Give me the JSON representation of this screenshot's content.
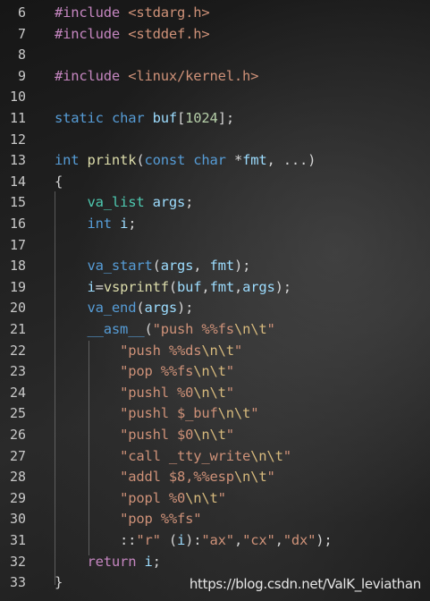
{
  "editor": {
    "lines": [
      {
        "n": "6",
        "tokens": [
          [
            "pre",
            "#include "
          ],
          [
            "inc",
            "<stdarg.h>"
          ]
        ]
      },
      {
        "n": "7",
        "tokens": [
          [
            "pre",
            "#include "
          ],
          [
            "inc",
            "<stddef.h>"
          ]
        ]
      },
      {
        "n": "8",
        "tokens": []
      },
      {
        "n": "9",
        "tokens": [
          [
            "pre",
            "#include "
          ],
          [
            "inc",
            "<linux/kernel.h>"
          ]
        ]
      },
      {
        "n": "10",
        "tokens": []
      },
      {
        "n": "11",
        "tokens": [
          [
            "kw",
            "static "
          ],
          [
            "kw",
            "char "
          ],
          [
            "var",
            "buf"
          ],
          [
            "plain",
            "["
          ],
          [
            "num",
            "1024"
          ],
          [
            "plain",
            "];"
          ]
        ]
      },
      {
        "n": "12",
        "tokens": []
      },
      {
        "n": "13",
        "tokens": [
          [
            "kw",
            "int "
          ],
          [
            "fn",
            "printk"
          ],
          [
            "plain",
            "("
          ],
          [
            "kw",
            "const "
          ],
          [
            "kw",
            "char "
          ],
          [
            "plain",
            "*"
          ],
          [
            "var",
            "fmt"
          ],
          [
            "plain",
            ", ...)"
          ]
        ]
      },
      {
        "n": "14",
        "tokens": [
          [
            "plain",
            "{"
          ]
        ]
      },
      {
        "n": "15",
        "tokens": [
          [
            "plain",
            "    "
          ],
          [
            "type",
            "va_list "
          ],
          [
            "var",
            "args"
          ],
          [
            "plain",
            ";"
          ]
        ]
      },
      {
        "n": "16",
        "tokens": [
          [
            "plain",
            "    "
          ],
          [
            "kw",
            "int "
          ],
          [
            "var",
            "i"
          ],
          [
            "plain",
            ";"
          ]
        ]
      },
      {
        "n": "17",
        "tokens": []
      },
      {
        "n": "18",
        "tokens": [
          [
            "plain",
            "    "
          ],
          [
            "kw",
            "va_start"
          ],
          [
            "plain",
            "("
          ],
          [
            "var",
            "args"
          ],
          [
            "plain",
            ", "
          ],
          [
            "var",
            "fmt"
          ],
          [
            "plain",
            ");"
          ]
        ]
      },
      {
        "n": "19",
        "tokens": [
          [
            "plain",
            "    "
          ],
          [
            "var",
            "i"
          ],
          [
            "plain",
            "="
          ],
          [
            "fn",
            "vsprintf"
          ],
          [
            "plain",
            "("
          ],
          [
            "var",
            "buf"
          ],
          [
            "plain",
            ","
          ],
          [
            "var",
            "fmt"
          ],
          [
            "plain",
            ","
          ],
          [
            "var",
            "args"
          ],
          [
            "plain",
            ");"
          ]
        ]
      },
      {
        "n": "20",
        "tokens": [
          [
            "plain",
            "    "
          ],
          [
            "kw",
            "va_end"
          ],
          [
            "plain",
            "("
          ],
          [
            "var",
            "args"
          ],
          [
            "plain",
            ");"
          ]
        ]
      },
      {
        "n": "21",
        "tokens": [
          [
            "plain",
            "    "
          ],
          [
            "kw",
            "__asm__"
          ],
          [
            "plain",
            "("
          ],
          [
            "str",
            "\"push %%fs"
          ],
          [
            "esc",
            "\\n\\t"
          ],
          [
            "str",
            "\""
          ]
        ]
      },
      {
        "n": "22",
        "tokens": [
          [
            "plain",
            "        "
          ],
          [
            "str",
            "\"push %%ds"
          ],
          [
            "esc",
            "\\n\\t"
          ],
          [
            "str",
            "\""
          ]
        ]
      },
      {
        "n": "23",
        "tokens": [
          [
            "plain",
            "        "
          ],
          [
            "str",
            "\"pop %%fs"
          ],
          [
            "esc",
            "\\n\\t"
          ],
          [
            "str",
            "\""
          ]
        ]
      },
      {
        "n": "24",
        "tokens": [
          [
            "plain",
            "        "
          ],
          [
            "str",
            "\"pushl %0"
          ],
          [
            "esc",
            "\\n\\t"
          ],
          [
            "str",
            "\""
          ]
        ]
      },
      {
        "n": "25",
        "tokens": [
          [
            "plain",
            "        "
          ],
          [
            "str",
            "\"pushl $_buf"
          ],
          [
            "esc",
            "\\n\\t"
          ],
          [
            "str",
            "\""
          ]
        ]
      },
      {
        "n": "26",
        "tokens": [
          [
            "plain",
            "        "
          ],
          [
            "str",
            "\"pushl $0"
          ],
          [
            "esc",
            "\\n\\t"
          ],
          [
            "str",
            "\""
          ]
        ]
      },
      {
        "n": "27",
        "tokens": [
          [
            "plain",
            "        "
          ],
          [
            "str",
            "\"call _tty_write"
          ],
          [
            "esc",
            "\\n\\t"
          ],
          [
            "str",
            "\""
          ]
        ]
      },
      {
        "n": "28",
        "tokens": [
          [
            "plain",
            "        "
          ],
          [
            "str",
            "\"addl $8,%%esp"
          ],
          [
            "esc",
            "\\n\\t"
          ],
          [
            "str",
            "\""
          ]
        ]
      },
      {
        "n": "29",
        "tokens": [
          [
            "plain",
            "        "
          ],
          [
            "str",
            "\"popl %0"
          ],
          [
            "esc",
            "\\n\\t"
          ],
          [
            "str",
            "\""
          ]
        ]
      },
      {
        "n": "30",
        "tokens": [
          [
            "plain",
            "        "
          ],
          [
            "str",
            "\"pop %%fs\""
          ]
        ]
      },
      {
        "n": "31",
        "tokens": [
          [
            "plain",
            "        ::"
          ],
          [
            "str",
            "\"r\""
          ],
          [
            "plain",
            " ("
          ],
          [
            "var",
            "i"
          ],
          [
            "plain",
            "):"
          ],
          [
            "str",
            "\"ax\""
          ],
          [
            "plain",
            ","
          ],
          [
            "str",
            "\"cx\""
          ],
          [
            "plain",
            ","
          ],
          [
            "str",
            "\"dx\""
          ],
          [
            "plain",
            ");"
          ]
        ]
      },
      {
        "n": "32",
        "tokens": [
          [
            "plain",
            "    "
          ],
          [
            "ctl",
            "return "
          ],
          [
            "var",
            "i"
          ],
          [
            "plain",
            ";"
          ]
        ]
      },
      {
        "n": "33",
        "tokens": [
          [
            "plain",
            "}"
          ]
        ]
      }
    ]
  },
  "watermark": "https://blog.csdn.net/ValK_leviathan"
}
